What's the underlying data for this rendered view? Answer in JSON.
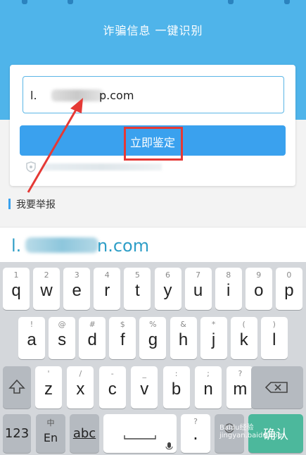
{
  "header": {
    "title": "诈骗信息 一键识别"
  },
  "form": {
    "input_prefix": "l.",
    "input_suffix": "p.com",
    "verify_label": "立即鉴定"
  },
  "report": {
    "label": "我要举报"
  },
  "suggestion": {
    "prefix": "l.",
    "suffix": "n.com"
  },
  "keyboard": {
    "row1": [
      {
        "sub": "1",
        "main": "q"
      },
      {
        "sub": "2",
        "main": "w"
      },
      {
        "sub": "3",
        "main": "e"
      },
      {
        "sub": "4",
        "main": "r"
      },
      {
        "sub": "5",
        "main": "t"
      },
      {
        "sub": "6",
        "main": "y"
      },
      {
        "sub": "7",
        "main": "u"
      },
      {
        "sub": "8",
        "main": "i"
      },
      {
        "sub": "9",
        "main": "o"
      },
      {
        "sub": "0",
        "main": "p"
      }
    ],
    "row2": [
      {
        "sub": "!",
        "main": "a"
      },
      {
        "sub": "@",
        "main": "s"
      },
      {
        "sub": "#",
        "main": "d"
      },
      {
        "sub": "$",
        "main": "f"
      },
      {
        "sub": "%",
        "main": "g"
      },
      {
        "sub": "&",
        "main": "h"
      },
      {
        "sub": "*",
        "main": "j"
      },
      {
        "sub": "(",
        "main": "k"
      },
      {
        "sub": ")",
        "main": "l"
      }
    ],
    "row3": [
      {
        "sub": "'",
        "main": "z"
      },
      {
        "sub": "/",
        "main": "x"
      },
      {
        "sub": "-",
        "main": "c"
      },
      {
        "sub": "_",
        "main": "v"
      },
      {
        "sub": ":",
        "main": "b"
      },
      {
        "sub": ";",
        "main": "n"
      },
      {
        "sub": "?",
        "main": "m"
      }
    ],
    "num_label": "123",
    "lang_top": "中",
    "lang_bottom": "En",
    "abc_label": "abc",
    "dot_label": ".",
    "dot_sub": "?",
    "confirm_label": "确认"
  },
  "watermark": "Baidu经验 jingyan.baidu.com",
  "colors": {
    "header": "#4fb4ea",
    "button": "#3aa1ee",
    "highlight": "#e53935",
    "confirm": "#4cb89c"
  }
}
